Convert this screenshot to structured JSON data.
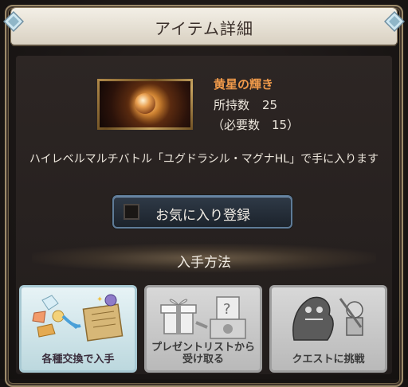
{
  "header": {
    "title": "アイテム詳細"
  },
  "item": {
    "name": "黄星の輝き",
    "owned_label": "所持数",
    "owned_value": "25",
    "needed_text": "（必要数　15）",
    "description": "ハイレベルマルチバトル「ユグドラシル・マグナHL」で手に入ります"
  },
  "favorite": {
    "label": "お気に入り登録",
    "checked": false
  },
  "acquire": {
    "title": "入手方法",
    "methods": [
      {
        "label": "各種交換で入手",
        "enabled": true
      },
      {
        "label": "プレゼントリストから\n受け取る",
        "enabled": false
      },
      {
        "label": "クエストに挑戦",
        "enabled": false
      }
    ]
  },
  "colors": {
    "item_name": "#f09a4a",
    "accent_blue": "#5f7c98",
    "card_active": "#bcd8de",
    "card_disabled": "#b9b9b9"
  }
}
